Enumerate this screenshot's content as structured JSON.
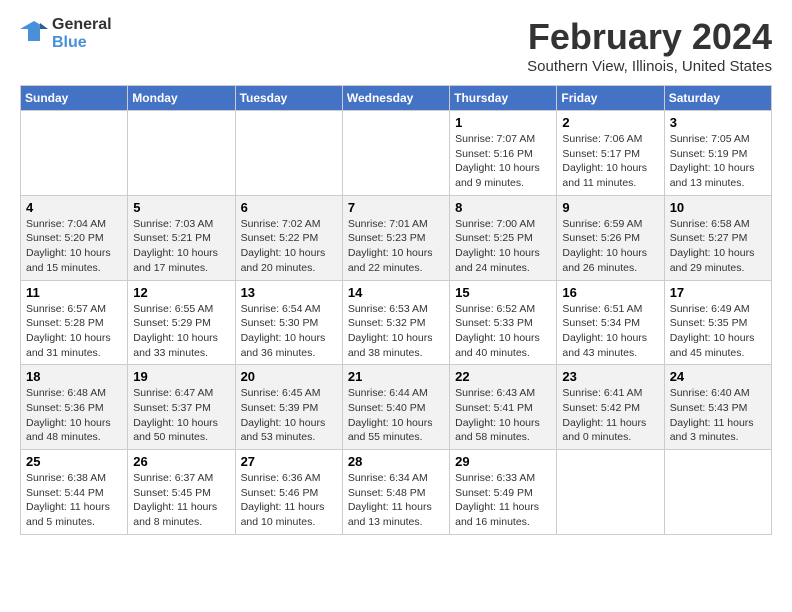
{
  "header": {
    "logo_line1": "General",
    "logo_line2": "Blue",
    "month_year": "February 2024",
    "location": "Southern View, Illinois, United States"
  },
  "days_of_week": [
    "Sunday",
    "Monday",
    "Tuesday",
    "Wednesday",
    "Thursday",
    "Friday",
    "Saturday"
  ],
  "weeks": [
    [
      {
        "day": "",
        "info": ""
      },
      {
        "day": "",
        "info": ""
      },
      {
        "day": "",
        "info": ""
      },
      {
        "day": "",
        "info": ""
      },
      {
        "day": "1",
        "info": "Sunrise: 7:07 AM\nSunset: 5:16 PM\nDaylight: 10 hours\nand 9 minutes."
      },
      {
        "day": "2",
        "info": "Sunrise: 7:06 AM\nSunset: 5:17 PM\nDaylight: 10 hours\nand 11 minutes."
      },
      {
        "day": "3",
        "info": "Sunrise: 7:05 AM\nSunset: 5:19 PM\nDaylight: 10 hours\nand 13 minutes."
      }
    ],
    [
      {
        "day": "4",
        "info": "Sunrise: 7:04 AM\nSunset: 5:20 PM\nDaylight: 10 hours\nand 15 minutes."
      },
      {
        "day": "5",
        "info": "Sunrise: 7:03 AM\nSunset: 5:21 PM\nDaylight: 10 hours\nand 17 minutes."
      },
      {
        "day": "6",
        "info": "Sunrise: 7:02 AM\nSunset: 5:22 PM\nDaylight: 10 hours\nand 20 minutes."
      },
      {
        "day": "7",
        "info": "Sunrise: 7:01 AM\nSunset: 5:23 PM\nDaylight: 10 hours\nand 22 minutes."
      },
      {
        "day": "8",
        "info": "Sunrise: 7:00 AM\nSunset: 5:25 PM\nDaylight: 10 hours\nand 24 minutes."
      },
      {
        "day": "9",
        "info": "Sunrise: 6:59 AM\nSunset: 5:26 PM\nDaylight: 10 hours\nand 26 minutes."
      },
      {
        "day": "10",
        "info": "Sunrise: 6:58 AM\nSunset: 5:27 PM\nDaylight: 10 hours\nand 29 minutes."
      }
    ],
    [
      {
        "day": "11",
        "info": "Sunrise: 6:57 AM\nSunset: 5:28 PM\nDaylight: 10 hours\nand 31 minutes."
      },
      {
        "day": "12",
        "info": "Sunrise: 6:55 AM\nSunset: 5:29 PM\nDaylight: 10 hours\nand 33 minutes."
      },
      {
        "day": "13",
        "info": "Sunrise: 6:54 AM\nSunset: 5:30 PM\nDaylight: 10 hours\nand 36 minutes."
      },
      {
        "day": "14",
        "info": "Sunrise: 6:53 AM\nSunset: 5:32 PM\nDaylight: 10 hours\nand 38 minutes."
      },
      {
        "day": "15",
        "info": "Sunrise: 6:52 AM\nSunset: 5:33 PM\nDaylight: 10 hours\nand 40 minutes."
      },
      {
        "day": "16",
        "info": "Sunrise: 6:51 AM\nSunset: 5:34 PM\nDaylight: 10 hours\nand 43 minutes."
      },
      {
        "day": "17",
        "info": "Sunrise: 6:49 AM\nSunset: 5:35 PM\nDaylight: 10 hours\nand 45 minutes."
      }
    ],
    [
      {
        "day": "18",
        "info": "Sunrise: 6:48 AM\nSunset: 5:36 PM\nDaylight: 10 hours\nand 48 minutes."
      },
      {
        "day": "19",
        "info": "Sunrise: 6:47 AM\nSunset: 5:37 PM\nDaylight: 10 hours\nand 50 minutes."
      },
      {
        "day": "20",
        "info": "Sunrise: 6:45 AM\nSunset: 5:39 PM\nDaylight: 10 hours\nand 53 minutes."
      },
      {
        "day": "21",
        "info": "Sunrise: 6:44 AM\nSunset: 5:40 PM\nDaylight: 10 hours\nand 55 minutes."
      },
      {
        "day": "22",
        "info": "Sunrise: 6:43 AM\nSunset: 5:41 PM\nDaylight: 10 hours\nand 58 minutes."
      },
      {
        "day": "23",
        "info": "Sunrise: 6:41 AM\nSunset: 5:42 PM\nDaylight: 11 hours\nand 0 minutes."
      },
      {
        "day": "24",
        "info": "Sunrise: 6:40 AM\nSunset: 5:43 PM\nDaylight: 11 hours\nand 3 minutes."
      }
    ],
    [
      {
        "day": "25",
        "info": "Sunrise: 6:38 AM\nSunset: 5:44 PM\nDaylight: 11 hours\nand 5 minutes."
      },
      {
        "day": "26",
        "info": "Sunrise: 6:37 AM\nSunset: 5:45 PM\nDaylight: 11 hours\nand 8 minutes."
      },
      {
        "day": "27",
        "info": "Sunrise: 6:36 AM\nSunset: 5:46 PM\nDaylight: 11 hours\nand 10 minutes."
      },
      {
        "day": "28",
        "info": "Sunrise: 6:34 AM\nSunset: 5:48 PM\nDaylight: 11 hours\nand 13 minutes."
      },
      {
        "day": "29",
        "info": "Sunrise: 6:33 AM\nSunset: 5:49 PM\nDaylight: 11 hours\nand 16 minutes."
      },
      {
        "day": "",
        "info": ""
      },
      {
        "day": "",
        "info": ""
      }
    ]
  ]
}
